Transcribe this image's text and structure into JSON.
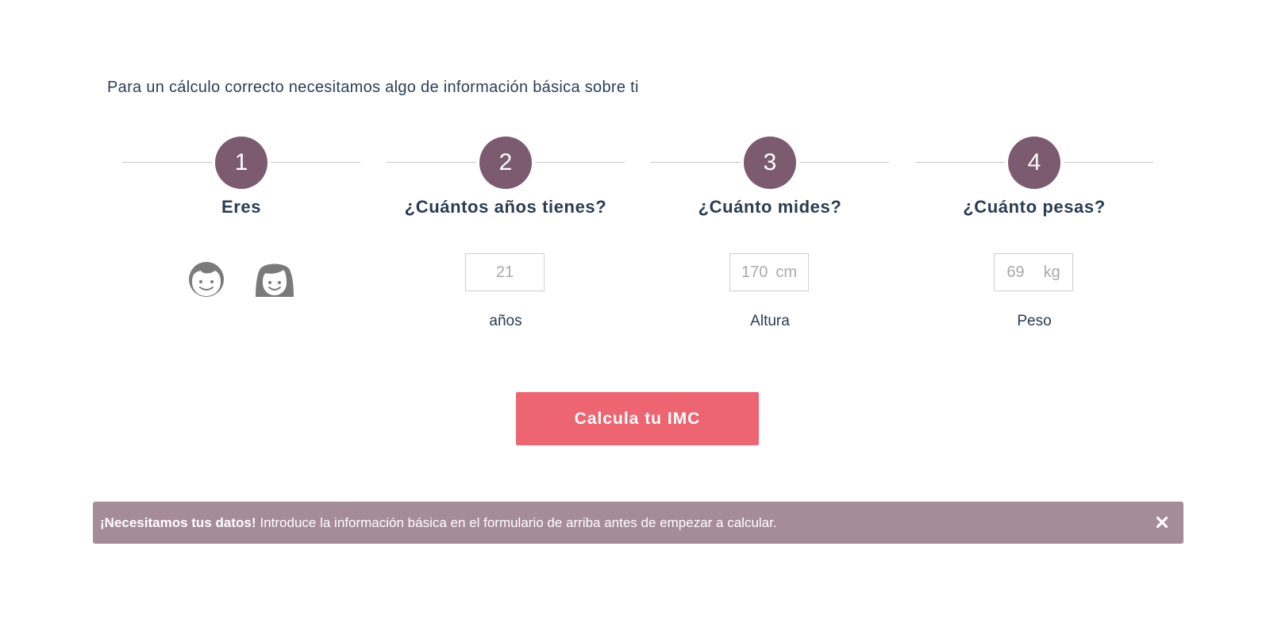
{
  "intro_text": "Para un cálculo correcto necesitamos algo de información básica sobre ti",
  "steps": [
    {
      "number": "1",
      "title": "Eres"
    },
    {
      "number": "2",
      "title": "¿Cuántos años tienes?",
      "value": "21",
      "caption": "años"
    },
    {
      "number": "3",
      "title": "¿Cuánto mides?",
      "value": "170",
      "unit": "cm",
      "caption": "Altura"
    },
    {
      "number": "4",
      "title": "¿Cuánto pesas?",
      "value": "69",
      "unit": "kg",
      "caption": "Peso"
    }
  ],
  "gender_icons": [
    "male-face-icon",
    "female-face-icon"
  ],
  "cta": {
    "label": "Calcula tu IMC"
  },
  "alert": {
    "title": "¡Necesitamos tus datos!",
    "message": "Introduce la información básica en el formulario de arriba antes de empezar a calcular.",
    "close_icon": "close-icon"
  },
  "colors": {
    "step_circle": "#7c5a70",
    "cta_background": "#ec6571",
    "alert_background": "#a68b98",
    "heading_text": "#2b3b52"
  }
}
